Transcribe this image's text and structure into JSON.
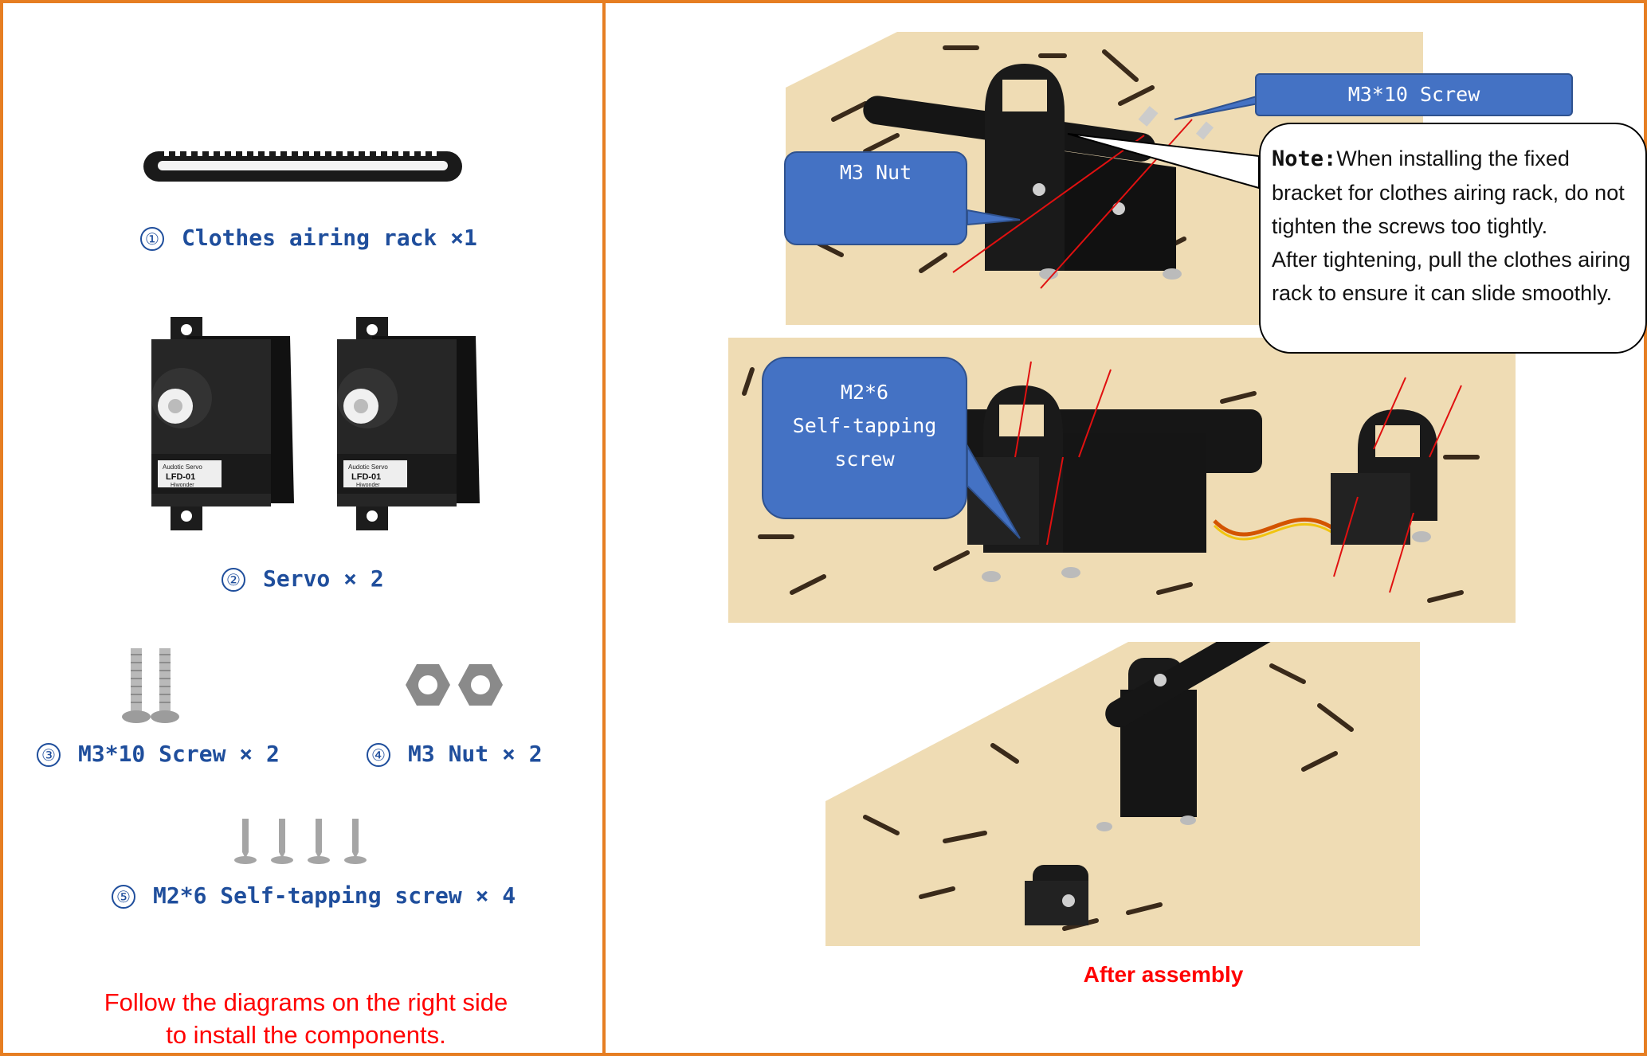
{
  "parts": [
    {
      "number": "①",
      "label": "Clothes airing rack ×1"
    },
    {
      "number": "②",
      "label": "Servo × 2"
    },
    {
      "number": "③",
      "label": "M3*10 Screw × 2"
    },
    {
      "number": "④",
      "label": "M3 Nut × 2"
    },
    {
      "number": "⑤",
      "label": "M2*6 Self-tapping screw × 4"
    }
  ],
  "servo_sticker": {
    "brand": "Audotic Servo",
    "model": "LFD-01",
    "maker": "Hiwonder"
  },
  "instruction": {
    "line1": "Follow the diagrams on the right side",
    "line2": "to install the components."
  },
  "callouts": {
    "m3_screw": "M3*10 Screw",
    "m3_nut": "M3 Nut",
    "m2_screw_line1": "M2*6",
    "m2_screw_line2": "Self-tapping",
    "m2_screw_line3": "screw"
  },
  "note": {
    "label": "Note:",
    "line1": "When installing the fixed",
    "line2": "bracket for clothes airing rack, do not",
    "line3": "tighten the screws too tightly.",
    "line4": "After tightening, pull the clothes airing",
    "line5": "rack to ensure it can slide smoothly."
  },
  "after_assembly": "After assembly",
  "colors": {
    "frame": "#e67e22",
    "label_blue": "#1f4e9c",
    "callout_blue": "#4472c4",
    "red": "#ff0000",
    "wood": "#efdcb4"
  }
}
